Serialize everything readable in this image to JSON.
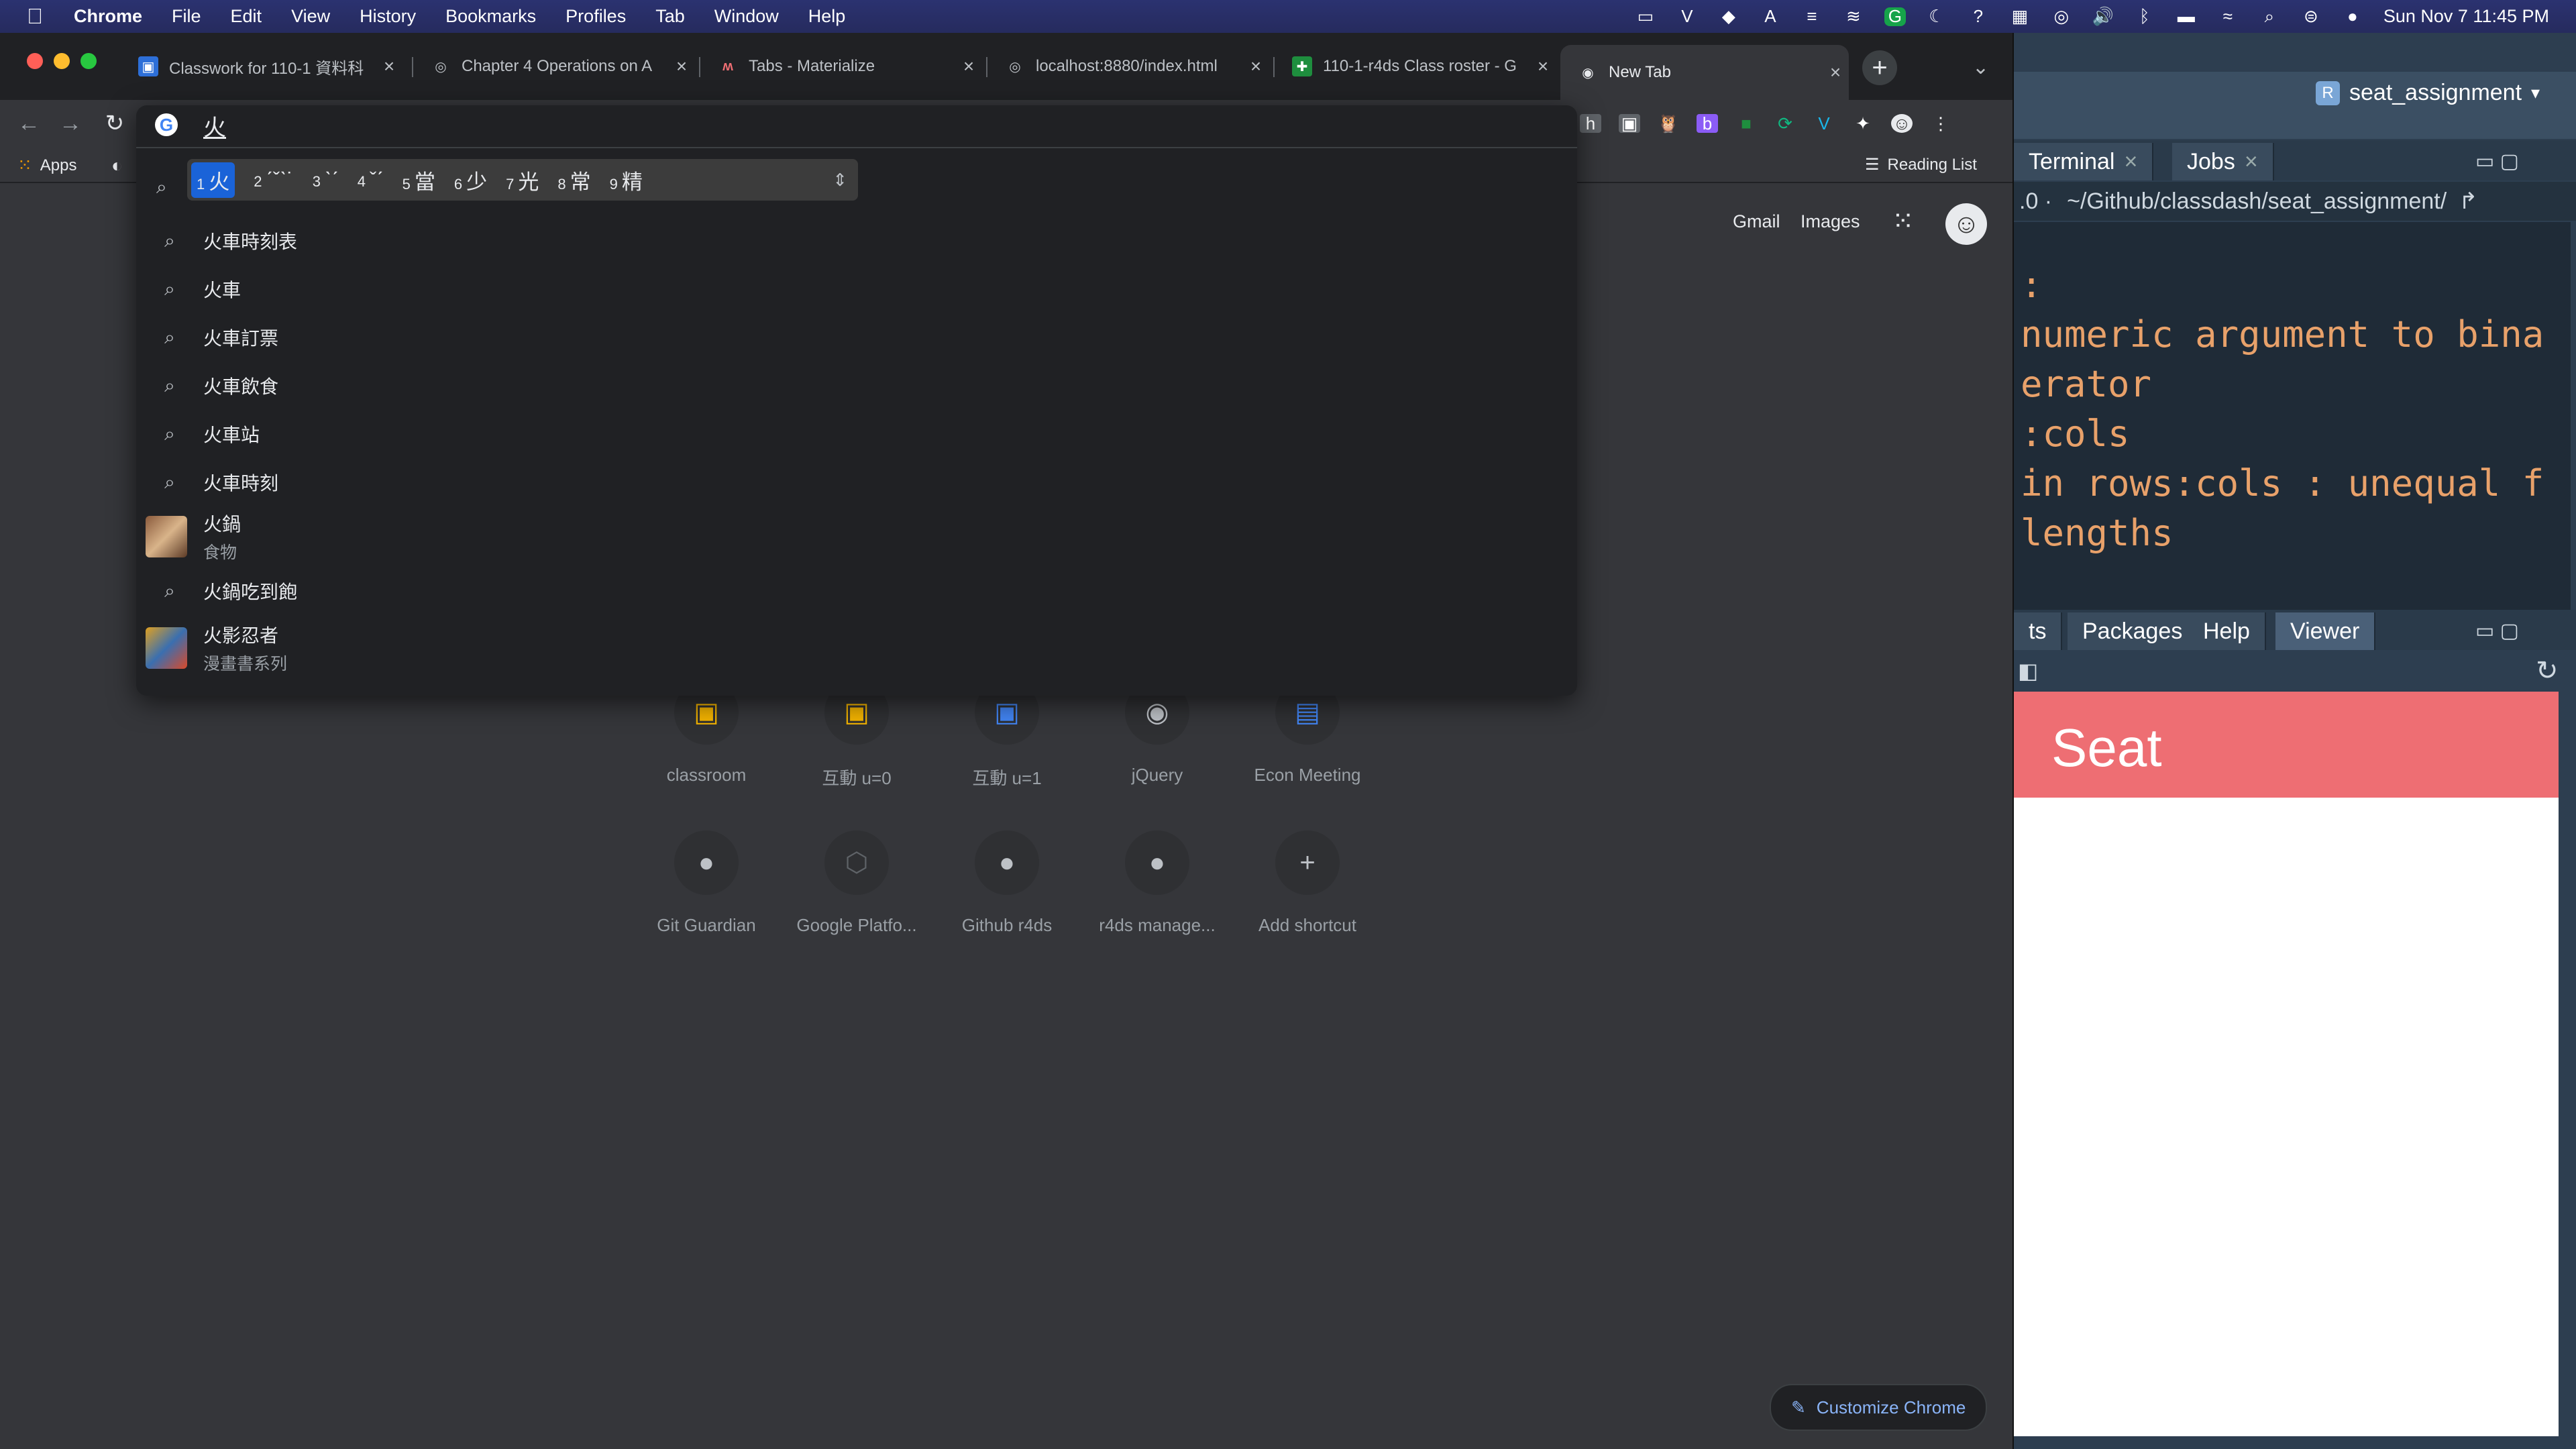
{
  "menubar": {
    "app": "Chrome",
    "items": [
      "File",
      "Edit",
      "View",
      "History",
      "Bookmarks",
      "Profiles",
      "Tab",
      "Window",
      "Help"
    ],
    "datetime": "Sun Nov 7  11:45 PM"
  },
  "tabs": [
    {
      "title": "Classwork for 110-1 資料科",
      "favicon": "classroom-icon"
    },
    {
      "title": "Chapter 4 Operations on A",
      "favicon": "globe-icon"
    },
    {
      "title": "Tabs - Materialize",
      "favicon": "materialize-icon"
    },
    {
      "title": "localhost:8880/index.html",
      "favicon": "globe-icon"
    },
    {
      "title": "110-1-r4ds Class roster - G",
      "favicon": "sheets-icon"
    },
    {
      "title": "New Tab",
      "favicon": "chrome-icon"
    }
  ],
  "omnibox": {
    "value": "火"
  },
  "bookmarks": {
    "apps_label": "Apps",
    "reading_list": "Reading List"
  },
  "ime": {
    "candidates": [
      {
        "n": "1",
        "c": "火"
      },
      {
        "n": "2",
        "c": "ˊˇˋ˙"
      },
      {
        "n": "3",
        "c": "ˋˊ"
      },
      {
        "n": "4",
        "c": "ˇˊ"
      },
      {
        "n": "5",
        "c": "當"
      },
      {
        "n": "6",
        "c": "少"
      },
      {
        "n": "7",
        "c": "光"
      },
      {
        "n": "8",
        "c": "常"
      },
      {
        "n": "9",
        "c": "精"
      }
    ]
  },
  "suggestions": [
    {
      "text": "火車時刻表"
    },
    {
      "text": "火車"
    },
    {
      "text": "火車訂票"
    },
    {
      "text": "火車飲食"
    },
    {
      "text": "火車站"
    },
    {
      "text": "火車時刻"
    },
    {
      "text": "火鍋",
      "sub": "食物"
    },
    {
      "text": "火鍋吃到飽"
    },
    {
      "text": "火影忍者",
      "sub": "漫畫書系列"
    }
  ],
  "ntp": {
    "gmail": "Gmail",
    "images": "Images",
    "shortcuts_row1": [
      "classroom",
      "互動 u=0",
      "互動 u=1",
      "jQuery",
      "Econ Meeting"
    ],
    "shortcuts_row2": [
      "Git Guardian",
      "Google Platfo...",
      "Github r4ds",
      "r4ds manage...",
      "Add shortcut"
    ],
    "customize": "Customize Chrome"
  },
  "rstudio": {
    "project": "seat_assignment",
    "tabs_top": [
      "Terminal",
      "Jobs"
    ],
    "path": "~/Github/classdash/seat_assignment/",
    "console_lines": [
      ": ",
      "numeric argument to bina",
      "erator",
      ":cols",
      "in rows:cols : unequal f",
      "lengths"
    ],
    "tabs_bottom": [
      "ts",
      "Packages",
      "Help",
      "Viewer"
    ],
    "viewer_title": "Seat"
  }
}
